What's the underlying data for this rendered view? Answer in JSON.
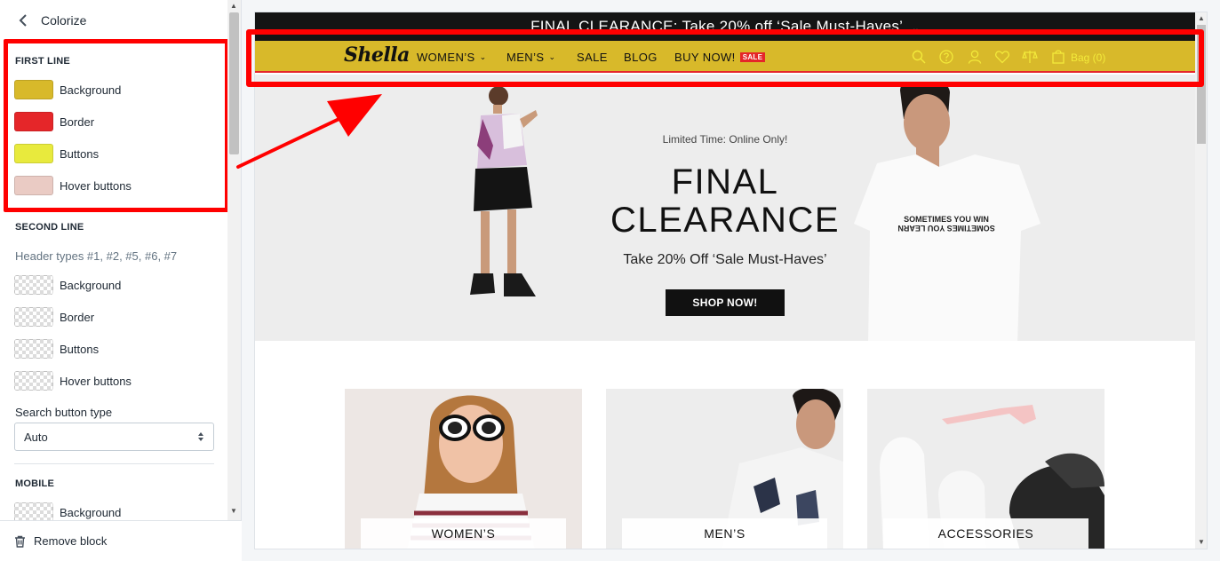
{
  "sidebar": {
    "title": "Colorize",
    "first_line": {
      "heading": "FIRST LINE",
      "items": [
        {
          "label": "Background",
          "color": "#d8b92a"
        },
        {
          "label": "Border",
          "color": "#e52629"
        },
        {
          "label": "Buttons",
          "color": "#e8ea3d"
        },
        {
          "label": "Hover buttons",
          "color": "#eacbc4"
        }
      ]
    },
    "second_line": {
      "heading": "SECOND LINE",
      "help": "Header types #1, #2, #5, #6, #7",
      "items": [
        {
          "label": "Background",
          "color": "transparent"
        },
        {
          "label": "Border",
          "color": "transparent"
        },
        {
          "label": "Buttons",
          "color": "transparent"
        },
        {
          "label": "Hover buttons",
          "color": "transparent"
        }
      ]
    },
    "search_button_type": {
      "label": "Search button type",
      "value": "Auto"
    },
    "mobile": {
      "heading": "MOBILE",
      "items": [
        {
          "label": "Background",
          "color": "transparent"
        }
      ]
    },
    "footer": {
      "remove_label": "Remove block"
    }
  },
  "preview": {
    "announcement": "FINAL CLEARANCE: Take 20% off ‘Sale Must-Haves’",
    "logo": "Shella",
    "nav": [
      {
        "label": "WOMEN’S",
        "dropdown": true
      },
      {
        "label": "MEN’S",
        "dropdown": true
      },
      {
        "label": "SALE",
        "dropdown": false
      },
      {
        "label": "BLOG",
        "dropdown": false
      },
      {
        "label": "BUY NOW!",
        "dropdown": false
      }
    ],
    "sale_badge": "SALE",
    "header_icons": [
      "search-icon",
      "help-icon",
      "account-icon",
      "wishlist-icon",
      "compare-icon",
      "bag-icon"
    ],
    "bag_label": "Bag (0)",
    "hero": {
      "kicker": "Limited Time: Online Only!",
      "title": "FINAL\nCLEARANCE",
      "subtitle": "Take 20% Off ‘Sale Must-Haves’",
      "button": "SHOP NOW!",
      "tshirt_text": "SOMETIMES YOU WIN\nSOMETIMES YOU LEARN"
    },
    "categories": [
      {
        "label": "WOMEN’S"
      },
      {
        "label": "MEN’S"
      },
      {
        "label": "ACCESSORIES"
      }
    ]
  },
  "colors": {
    "highlight": "#ff0000",
    "header_bg": "#d8b92a",
    "header_border": "#e52629",
    "header_icons": "#f3ea3a"
  }
}
